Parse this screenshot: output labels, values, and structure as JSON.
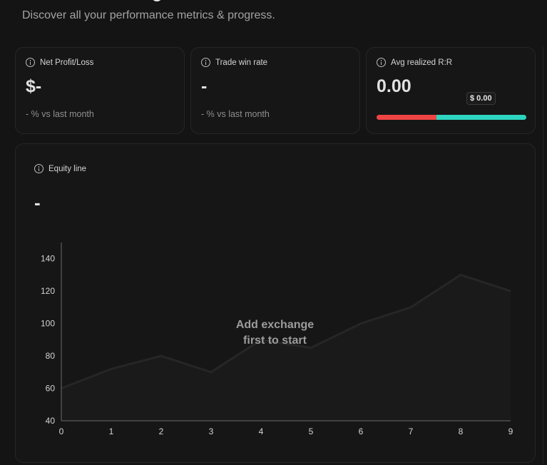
{
  "header": {
    "subtitle": "Discover all your performance metrics & progress."
  },
  "cards": {
    "net_profit": {
      "label": "Net Profit/Loss",
      "value": "$-",
      "sub": "- % vs last month"
    },
    "win_rate": {
      "label": "Trade win rate",
      "value": "-",
      "sub": "- % vs last month"
    },
    "avg_rr": {
      "label": "Avg realized R:R",
      "value": "0.00",
      "badge": "$ 0.00",
      "loss_fraction": 0.4,
      "loss_color": "#ef4444",
      "win_color": "#2dd4bf"
    }
  },
  "equity": {
    "label": "Equity line",
    "value": "-",
    "overlay_line1": "Add exchange",
    "overlay_line2": "first to start"
  },
  "chart_data": {
    "type": "area",
    "x": [
      0,
      1,
      2,
      3,
      4,
      5,
      6,
      7,
      8,
      9
    ],
    "series": [
      {
        "values": [
          60,
          72,
          80,
          70,
          90,
          85,
          100,
          110,
          130,
          120
        ]
      }
    ],
    "xticks": [
      "0",
      "1",
      "2",
      "3",
      "4",
      "5",
      "6",
      "7",
      "8",
      "9"
    ],
    "yticks": [
      "40",
      "60",
      "80",
      "100",
      "120",
      "140"
    ],
    "xlim": [
      0,
      9
    ],
    "ylim": [
      40,
      150
    ],
    "grid": false,
    "line_color": "#262626",
    "fill_color": "#1a1a1a"
  }
}
